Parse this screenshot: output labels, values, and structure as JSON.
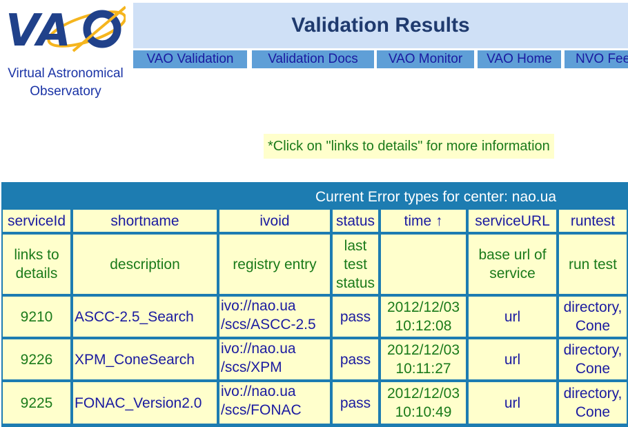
{
  "logo": {
    "caption_line1": "Virtual Astronomical",
    "caption_line2": "Observatory"
  },
  "header": {
    "title": "Validation Results"
  },
  "nav": {
    "items": [
      "VAO Validation",
      "Validation Docs",
      "VAO Monitor",
      "VAO Home",
      "NVO Feedback"
    ]
  },
  "note": "*Click on \"links to details\" for more information",
  "table": {
    "title": "Current Error types for center: nao.ua",
    "columns": [
      "serviceId",
      "shortname",
      "ivoid",
      "status",
      "time ↑",
      "serviceURL",
      "runtest"
    ],
    "subheaders": [
      "links to details",
      "description",
      "registry entry",
      "last test status",
      "",
      "base url of service",
      "run test"
    ],
    "rows": [
      {
        "serviceId": "9210",
        "shortname": "ASCC-2.5_Search",
        "ivoid_l1": "ivo://nao.ua",
        "ivoid_l2": "/scs/ASCC-2.5",
        "status": "pass",
        "date": "2012/12/03",
        "time": "10:12:08",
        "url": "url",
        "run_l1": "directory,",
        "run_l2": "Cone"
      },
      {
        "serviceId": "9226",
        "shortname": "XPM_ConeSearch",
        "ivoid_l1": "ivo://nao.ua",
        "ivoid_l2": "/scs/XPM",
        "status": "pass",
        "date": "2012/12/03",
        "time": "10:11:27",
        "url": "url",
        "run_l1": "directory,",
        "run_l2": "Cone"
      },
      {
        "serviceId": "9225",
        "shortname": "FONAC_Version2.0",
        "ivoid_l1": "ivo://nao.ua",
        "ivoid_l2": "/scs/FONAC",
        "status": "pass",
        "date": "2012/12/03",
        "time": "10:10:49",
        "url": "url",
        "run_l1": "directory,",
        "run_l2": "Cone"
      }
    ]
  },
  "colors": {
    "title_bg": "#cfe0f6",
    "nav_bg": "#5f9fd7",
    "table_border": "#1d7cb1",
    "cell_bg": "#ffffcc",
    "link": "#1a1aa0",
    "text_green": "#1a7a1a"
  }
}
